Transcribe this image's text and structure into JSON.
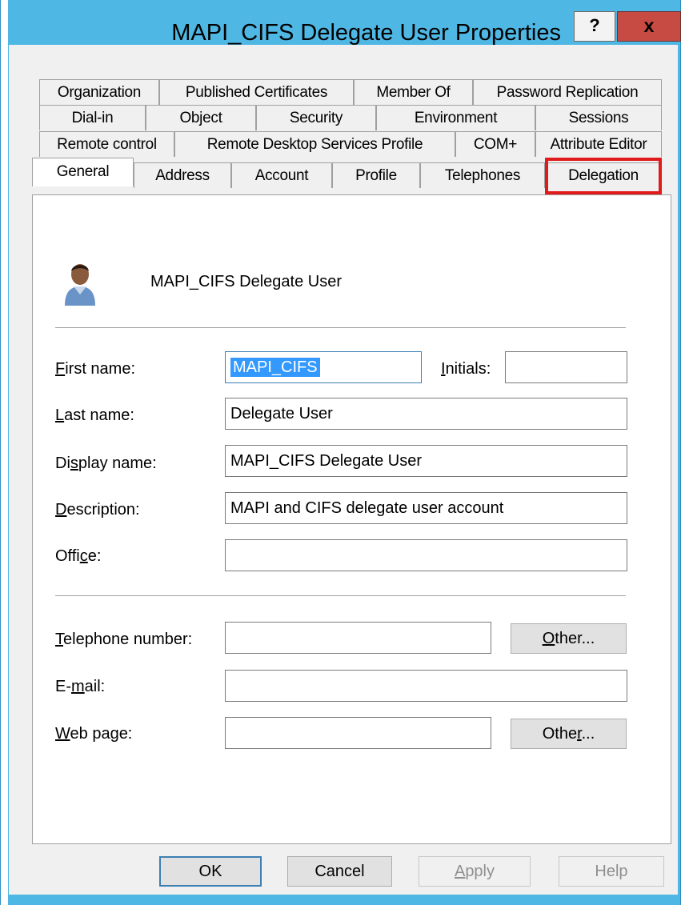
{
  "window": {
    "title": "MAPI_CIFS Delegate User Properties",
    "help_label": "?",
    "close_label": "x"
  },
  "tabs": {
    "row1": [
      "Organization",
      "Published Certificates",
      "Member Of",
      "Password Replication"
    ],
    "row2": [
      "Dial-in",
      "Object",
      "Security",
      "Environment",
      "Sessions"
    ],
    "row3": [
      "Remote control",
      "Remote Desktop Services Profile",
      "COM+",
      "Attribute Editor"
    ],
    "row4": [
      "General",
      "Address",
      "Account",
      "Profile",
      "Telephones",
      "Delegation"
    ],
    "active": "General",
    "highlighted": "Delegation"
  },
  "general": {
    "user_display": "MAPI_CIFS Delegate User",
    "first_name": {
      "pre": "",
      "u": "F",
      "post": "irst name:",
      "value": "MAPI_CIFS"
    },
    "initials": {
      "pre": "",
      "u": "I",
      "post": "nitials:",
      "value": ""
    },
    "last_name": {
      "pre": "",
      "u": "L",
      "post": "ast name:",
      "value": "Delegate User"
    },
    "display_name": {
      "pre": "Di",
      "u": "s",
      "post": "play name:",
      "value": "MAPI_CIFS Delegate User"
    },
    "description": {
      "pre": "",
      "u": "D",
      "post": "escription:",
      "value": "MAPI and CIFS delegate user account"
    },
    "office": {
      "pre": "Offi",
      "u": "c",
      "post": "e:",
      "value": ""
    },
    "telephone": {
      "pre": "",
      "u": "T",
      "post": "elephone number:",
      "value": ""
    },
    "email": {
      "pre": "E-",
      "u": "m",
      "post": "ail:",
      "value": ""
    },
    "webpage": {
      "pre": "",
      "u": "W",
      "post": "eb page:",
      "value": ""
    },
    "other_phone": {
      "pre": "",
      "u": "O",
      "post": "ther..."
    },
    "other_web": {
      "pre": "Othe",
      "u": "r",
      "post": "..."
    }
  },
  "footer": {
    "ok": "OK",
    "cancel": "Cancel",
    "apply": {
      "pre": "",
      "u": "A",
      "post": "pply"
    },
    "help": "Help"
  }
}
